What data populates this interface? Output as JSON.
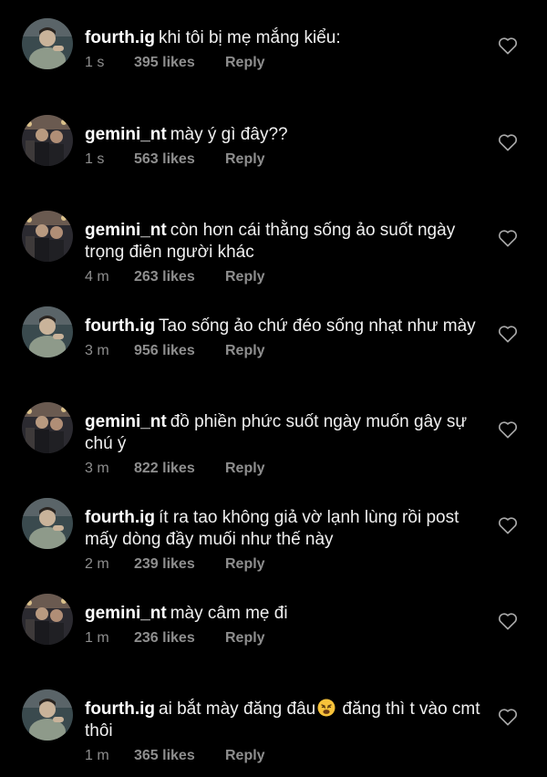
{
  "colors": {
    "background": "#000000",
    "username": "#ffffff",
    "meta": "#8e8e8e"
  },
  "comments": [
    {
      "user": "fourth.ig",
      "avatar": "fourth",
      "text": "khi tôi bị mẹ mắng kiểu:",
      "time": "1 s",
      "likes": "395 likes",
      "reply": "Reply"
    },
    {
      "user": "gemini_nt",
      "avatar": "gemini",
      "text": "mày ý gì đây??",
      "time": "1 s",
      "likes": "563 likes",
      "reply": "Reply"
    },
    {
      "user": "gemini_nt",
      "avatar": "gemini",
      "text": "còn hơn cái thằng sống ảo suốt ngày trọng điên người khác",
      "time": "4 m",
      "likes": "263 likes",
      "reply": "Reply"
    },
    {
      "user": "fourth.ig",
      "avatar": "fourth",
      "text": "Tao sống ảo chứ đéo sống nhạt như mày",
      "time": "3 m",
      "likes": "956 likes",
      "reply": "Reply"
    },
    {
      "user": "gemini_nt",
      "avatar": "gemini",
      "text": "đồ phiền phức suốt ngày muốn gây sự chú ý",
      "time": "3 m",
      "likes": "822 likes",
      "reply": "Reply"
    },
    {
      "user": "fourth.ig",
      "avatar": "fourth",
      "text": "ít ra tao không giả vờ lạnh lùng rồi post mấy dòng đầy muối như thế này",
      "time": "2 m",
      "likes": "239 likes",
      "reply": "Reply"
    },
    {
      "user": "gemini_nt",
      "avatar": "gemini",
      "text": "mày câm mẹ đi",
      "time": "1 m",
      "likes": "236 likes",
      "reply": "Reply"
    },
    {
      "user": "fourth.ig",
      "avatar": "fourth",
      "text_before": "ai bắt mày đăng đâu",
      "emoji": "weary-face-icon",
      "text_after": " đăng thì t vào cmt thôi",
      "time": "1 m",
      "likes": "365 likes",
      "reply": "Reply"
    }
  ]
}
